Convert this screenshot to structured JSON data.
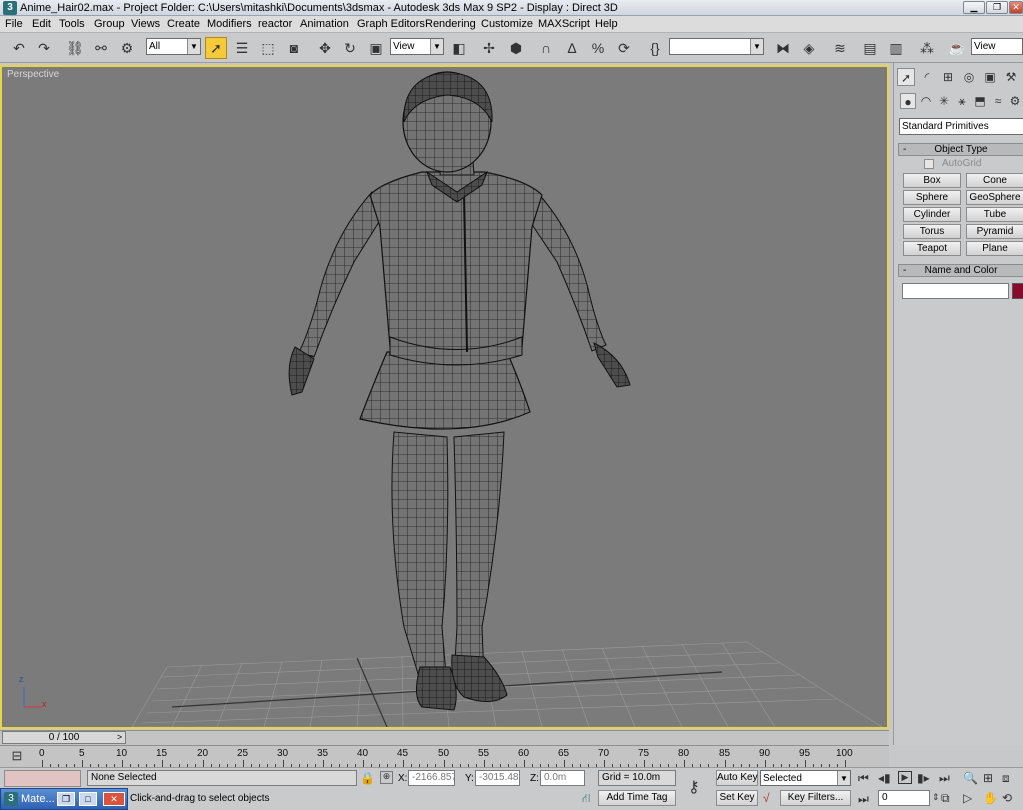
{
  "titlebar": {
    "app_icon": "3ds-max-icon",
    "title": "Anime_Hair02.max     - Project Folder: C:\\Users\\mitashki\\Documents\\3dsmax     - Autodesk 3ds Max 9 SP2     - Display : Direct 3D",
    "minimize": "minimize-icon",
    "maximize": "restore-icon",
    "close": "close-icon"
  },
  "menu": {
    "items": [
      "File",
      "Edit",
      "Tools",
      "Group",
      "Views",
      "Create",
      "Modifiers",
      "reactor",
      "Animation",
      "Graph Editors",
      "Rendering",
      "Customize",
      "MAXScript",
      "Help"
    ]
  },
  "toolbar": {
    "selection_filter": "All",
    "ref_coord": "View",
    "named_selection": "",
    "render_view": "View",
    "icons": [
      "undo-icon",
      "redo-icon",
      "select-link-icon",
      "unlink-icon",
      "bind-space-warp-icon",
      "select-object-icon",
      "select-by-name-icon",
      "rect-region-icon",
      "window-crossing-icon",
      "move-icon",
      "rotate-icon",
      "scale-icon",
      "pivot-icon",
      "manipulate-icon",
      "keyboard-shortcut-icon",
      "snap-3-icon",
      "angle-snap-icon",
      "percent-snap-icon",
      "spinner-snap-icon",
      "edit-named-sel-icon",
      "mirror-icon",
      "align-icon",
      "layer-manager-icon",
      "curve-editor-icon",
      "schematic-view-icon",
      "material-editor-icon",
      "render-scene-icon",
      "quick-render-icon"
    ]
  },
  "viewport": {
    "label": "Perspective",
    "axis_z": "z",
    "axis_x": "x"
  },
  "command_panel": {
    "tabs": [
      "create-tab-icon",
      "modify-tab-icon",
      "hierarchy-tab-icon",
      "motion-tab-icon",
      "display-tab-icon",
      "utilities-tab-icon"
    ],
    "subtabs": [
      "geometry-icon",
      "shapes-icon",
      "lights-icon",
      "cameras-icon",
      "helpers-icon",
      "space-warps-icon",
      "systems-icon"
    ],
    "category": "Standard Primitives",
    "object_type_header": "Object Type",
    "autogrid": "AutoGrid",
    "buttons": [
      "Box",
      "Cone",
      "Sphere",
      "GeoSphere",
      "Cylinder",
      "Tube",
      "Torus",
      "Pyramid",
      "Teapot",
      "Plane"
    ],
    "name_color_header": "Name and Color",
    "name_value": "",
    "color": "#8a0a2e"
  },
  "timeline": {
    "frame": "0 / 100",
    "labels": [
      "0",
      "5",
      "10",
      "15",
      "20",
      "25",
      "30",
      "35",
      "40",
      "45",
      "50",
      "55",
      "60",
      "65",
      "70",
      "75",
      "80",
      "85",
      "90",
      "95",
      "100"
    ]
  },
  "status": {
    "selection": "None Selected",
    "prompt": "Click-and-drag to select objects",
    "x_label": "X:",
    "x_value": "-2166.857r",
    "y_label": "Y:",
    "y_value": "-3015.486r",
    "z_label": "Z:",
    "z_value": "0.0m",
    "grid": "Grid = 10.0m",
    "add_time_tag": "Add Time Tag",
    "auto_key": "Auto Key",
    "set_key": "Set Key",
    "key_mode": "Selected",
    "key_filters": "Key Filters...",
    "current_frame": "0"
  },
  "taskbar": {
    "item": "Mate..."
  }
}
